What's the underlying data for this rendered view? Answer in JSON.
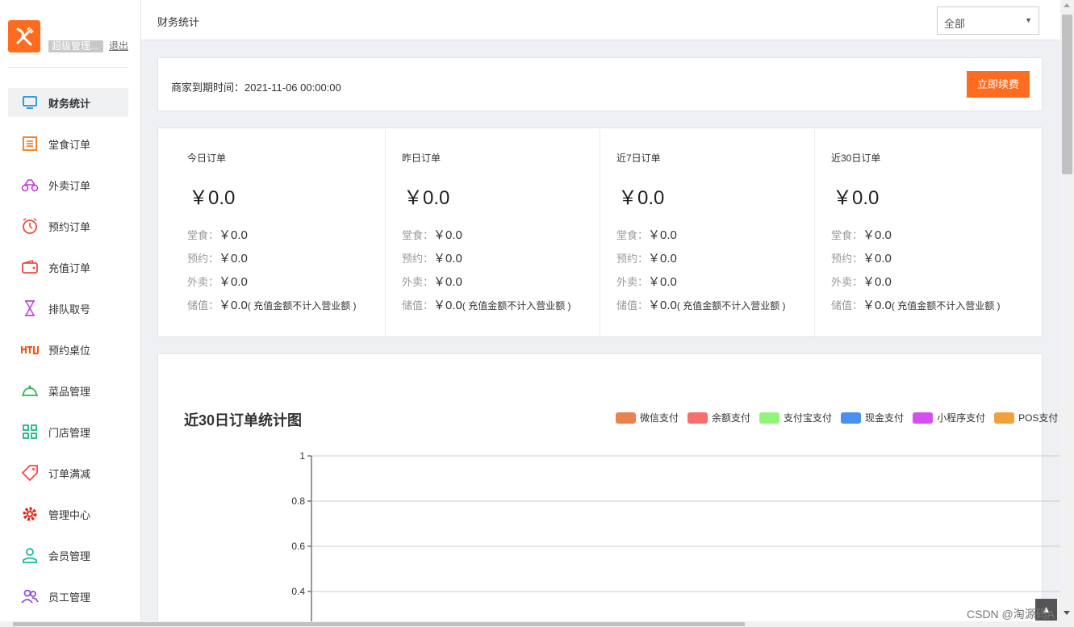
{
  "sidebar": {
    "admin_name": "超级管理...",
    "logout": "退出",
    "items": [
      {
        "label": "财务统计"
      },
      {
        "label": "堂食订单"
      },
      {
        "label": "外卖订单"
      },
      {
        "label": "预约订单"
      },
      {
        "label": "充值订单"
      },
      {
        "label": "排队取号"
      },
      {
        "label": "预约桌位"
      },
      {
        "label": "菜品管理"
      },
      {
        "label": "门店管理"
      },
      {
        "label": "订单满减"
      },
      {
        "label": "管理中心"
      },
      {
        "label": "会员管理"
      },
      {
        "label": "员工管理"
      }
    ]
  },
  "header": {
    "title": "财务统计",
    "store_select": "全部"
  },
  "expire": {
    "text": "商家到期时间：2021-11-06 00:00:00",
    "renew_button": "立即续费"
  },
  "stats": [
    {
      "title": "今日订单",
      "total": "￥0.0",
      "dine_label": "堂食：",
      "dine": "￥0.0",
      "reserve_label": "预约：",
      "reserve": "￥0.0",
      "takeout_label": "外卖：",
      "takeout": "￥0.0",
      "stored_label": "储值：",
      "stored": "￥0.0",
      "note": "( 充值金额不计入营业额 )"
    },
    {
      "title": "昨日订单",
      "total": "￥0.0",
      "dine_label": "堂食：",
      "dine": "￥0.0",
      "reserve_label": "预约：",
      "reserve": "￥0.0",
      "takeout_label": "外卖：",
      "takeout": "￥0.0",
      "stored_label": "储值：",
      "stored": "￥0.0",
      "note": "( 充值金额不计入营业额 )"
    },
    {
      "title": "近7日订单",
      "total": "￥0.0",
      "dine_label": "堂食：",
      "dine": "￥0.0",
      "reserve_label": "预约：",
      "reserve": "￥0.0",
      "takeout_label": "外卖：",
      "takeout": "￥0.0",
      "stored_label": "储值：",
      "stored": "￥0.0",
      "note": "( 充值金额不计入营业额 )"
    },
    {
      "title": "近30日订单",
      "total": "￥0.0",
      "dine_label": "堂食：",
      "dine": "￥0.0",
      "reserve_label": "预约：",
      "reserve": "￥0.0",
      "takeout_label": "外卖：",
      "takeout": "￥0.0",
      "stored_label": "储值：",
      "stored": "￥0.0",
      "note": "( 充值金额不计入营业额 )"
    }
  ],
  "colors": {
    "accent": "#ff6b1f"
  },
  "chart_data": {
    "type": "line",
    "title": "近30日订单统计图",
    "series": [
      {
        "name": "微信支付",
        "color": "#e8834d",
        "values": []
      },
      {
        "name": "余额支付",
        "color": "#f76e6e",
        "values": []
      },
      {
        "name": "支付宝支付",
        "color": "#91f57a",
        "values": []
      },
      {
        "name": "现金支付",
        "color": "#4a90f0",
        "values": []
      },
      {
        "name": "小程序支付",
        "color": "#d44ef0",
        "values": []
      },
      {
        "name": "POS支付",
        "color": "#f2a13a",
        "values": []
      }
    ],
    "yticks": [
      "1",
      "0.8",
      "0.6",
      "0.4"
    ],
    "ylim": [
      0,
      1
    ],
    "grid": true,
    "legend": "top-right"
  },
  "watermark": "CSDN @淘源码A",
  "to_top": "▲"
}
